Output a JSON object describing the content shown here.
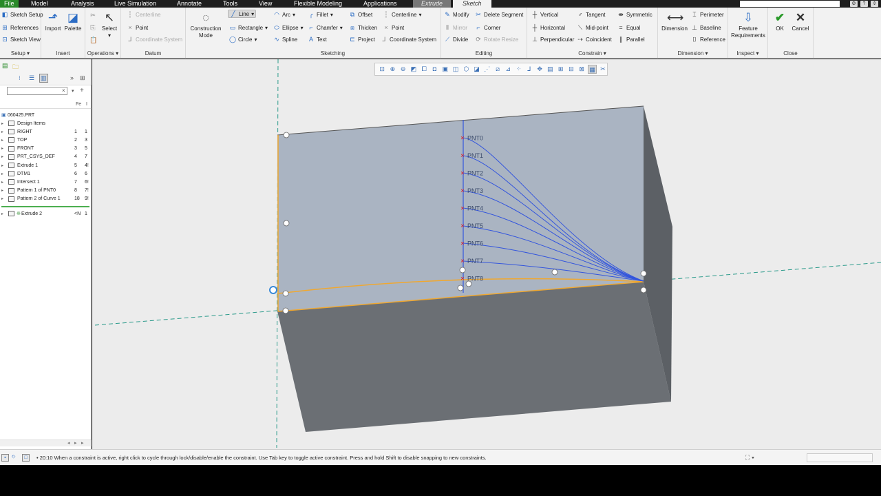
{
  "menubar": {
    "tabs": [
      "File",
      "Model",
      "Analysis",
      "Live Simulation",
      "Annotate",
      "Tools",
      "View",
      "Flexible Modeling",
      "Applications",
      "Extrude",
      "Sketch"
    ]
  },
  "ribbon": {
    "setup": {
      "title": "Setup",
      "items": [
        "Sketch Setup",
        "References",
        "Sketch View"
      ]
    },
    "insert": {
      "title": "Insert",
      "items": [
        "Import",
        "Palette"
      ]
    },
    "operations": {
      "title": "Operations",
      "select": "Select"
    },
    "datum": {
      "title": "Datum",
      "items": [
        "Centerline",
        "Point",
        "Coordinate System"
      ]
    },
    "construction": {
      "label1": "Construction",
      "label2": "Mode"
    },
    "sketching": {
      "title": "Sketching",
      "col1": [
        "Line",
        "Rectangle",
        "Circle"
      ],
      "col2": [
        "Arc",
        "Ellipse",
        "Spline"
      ],
      "col3": [
        "Fillet",
        "Chamfer",
        "Text"
      ],
      "col4": [
        "Offset",
        "Thicken",
        "Project"
      ],
      "col5": [
        "Centerline",
        "Point",
        "Coordinate System"
      ]
    },
    "editing": {
      "title": "Editing",
      "col1": [
        "Modify",
        "Mirror",
        "Divide"
      ],
      "col2": [
        "Delete Segment",
        "Corner",
        "Rotate Resize"
      ]
    },
    "constrain": {
      "title": "Constrain",
      "col1": [
        "Vertical",
        "Horizontal",
        "Perpendicular"
      ],
      "col2": [
        "Tangent",
        "Mid-point",
        "Coincident"
      ],
      "col3": [
        "Symmetric",
        "Equal",
        "Parallel"
      ]
    },
    "dimension": {
      "title": "Dimension",
      "big": "Dimension",
      "items": [
        "Perimeter",
        "Baseline",
        "Reference"
      ]
    },
    "inspect": {
      "title": "Inspect",
      "label1": "Feature",
      "label2": "Requirements"
    },
    "close": {
      "title": "Close",
      "ok": "OK",
      "cancel": "Cancel"
    }
  },
  "tree": {
    "header_col1": "Fe",
    "header_col2": "I",
    "root": "060425.PRT",
    "rows": [
      {
        "name": "Design Items",
        "c1": "",
        "c2": ""
      },
      {
        "name": "RIGHT",
        "c1": "1",
        "c2": "1"
      },
      {
        "name": "TOP",
        "c1": "2",
        "c2": "3"
      },
      {
        "name": "FRONT",
        "c1": "3",
        "c2": "5"
      },
      {
        "name": "PRT_CSYS_DEF",
        "c1": "4",
        "c2": "7"
      },
      {
        "name": "Extrude 1",
        "c1": "5",
        "c2": "4!"
      },
      {
        "name": "DTM1",
        "c1": "6",
        "c2": "6"
      },
      {
        "name": "Intersect 1",
        "c1": "7",
        "c2": "6!"
      },
      {
        "name": "Pattern 1 of PNT0",
        "c1": "8",
        "c2": "7!"
      },
      {
        "name": "Pattern 2 of Curve 1",
        "c1": "18",
        "c2": "9!"
      }
    ],
    "active": {
      "name": "Extrude 2",
      "c1": "<N",
      "c2": "1"
    }
  },
  "canvas": {
    "points": [
      "PNT0",
      "PNT1",
      "PNT2",
      "PNT3",
      "PNT4",
      "PNT5",
      "PNT6",
      "PNT7",
      "PNT8"
    ]
  },
  "status": {
    "message": "20:10 When a constraint is active, right click to cycle through lock/disable/enable the constraint. Use Tab key to toggle active constraint. Press and hold Shift to disable snapping to new constraints."
  },
  "colors": {
    "file_tab": "#2a8a2a",
    "sketch_entity": "#f0a830",
    "curve": "#3355dd",
    "point_marker": "#e02020"
  }
}
